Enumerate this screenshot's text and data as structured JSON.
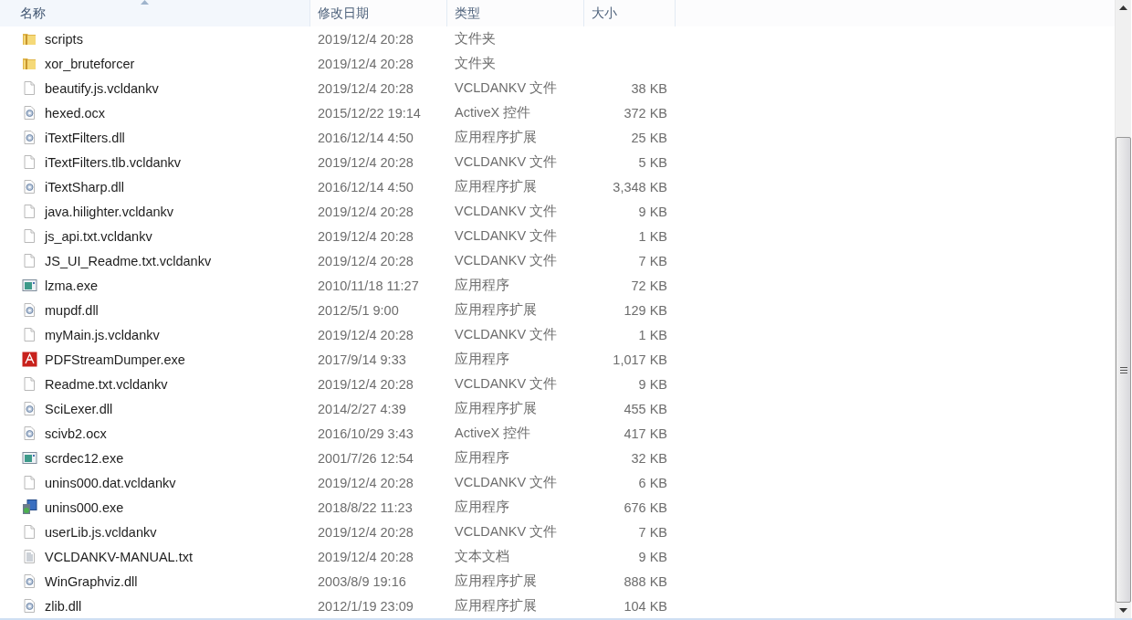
{
  "columns": [
    {
      "label": "名称",
      "sorted": true
    },
    {
      "label": "修改日期",
      "sorted": false
    },
    {
      "label": "类型",
      "sorted": false
    },
    {
      "label": "大小",
      "sorted": false
    }
  ],
  "files": [
    {
      "kind": "folder",
      "name": "scripts",
      "date": "2019/12/4 20:28",
      "type": "文件夹"
    },
    {
      "kind": "folder",
      "name": "xor_bruteforcer",
      "date": "2019/12/4 20:28",
      "type": "文件夹"
    },
    {
      "kind": "blank",
      "name": "beautify.js.vcldankv",
      "date": "2019/12/4 20:28",
      "type": "VCLDANKV 文件",
      "size": "38 KB"
    },
    {
      "kind": "library",
      "name": "hexed.ocx",
      "date": "2015/12/22 19:14",
      "type": "ActiveX 控件",
      "size": "372 KB"
    },
    {
      "kind": "library",
      "name": "iTextFilters.dll",
      "date": "2016/12/14 4:50",
      "type": "应用程序扩展",
      "size": "25 KB"
    },
    {
      "kind": "blank",
      "name": "iTextFilters.tlb.vcldankv",
      "date": "2019/12/4 20:28",
      "type": "VCLDANKV 文件",
      "size": "5 KB"
    },
    {
      "kind": "library",
      "name": "iTextSharp.dll",
      "date": "2016/12/14 4:50",
      "type": "应用程序扩展",
      "size": "3,348 KB"
    },
    {
      "kind": "blank",
      "name": "java.hilighter.vcldankv",
      "date": "2019/12/4 20:28",
      "type": "VCLDANKV 文件",
      "size": "9 KB"
    },
    {
      "kind": "blank",
      "name": "js_api.txt.vcldankv",
      "date": "2019/12/4 20:28",
      "type": "VCLDANKV 文件",
      "size": "1 KB"
    },
    {
      "kind": "blank",
      "name": "JS_UI_Readme.txt.vcldankv",
      "date": "2019/12/4 20:28",
      "type": "VCLDANKV 文件",
      "size": "7 KB"
    },
    {
      "kind": "program",
      "name": "lzma.exe",
      "date": "2010/11/18 11:27",
      "type": "应用程序",
      "size": "72 KB"
    },
    {
      "kind": "library",
      "name": "mupdf.dll",
      "date": "2012/5/1 9:00",
      "type": "应用程序扩展",
      "size": "129 KB"
    },
    {
      "kind": "blank",
      "name": "myMain.js.vcldankv",
      "date": "2019/12/4 20:28",
      "type": "VCLDANKV 文件",
      "size": "1 KB"
    },
    {
      "kind": "pdf",
      "name": "PDFStreamDumper.exe",
      "date": "2017/9/14 9:33",
      "type": "应用程序",
      "size": "1,017 KB"
    },
    {
      "kind": "blank",
      "name": "Readme.txt.vcldankv",
      "date": "2019/12/4 20:28",
      "type": "VCLDANKV 文件",
      "size": "9 KB"
    },
    {
      "kind": "library",
      "name": "SciLexer.dll",
      "date": "2014/2/27 4:39",
      "type": "应用程序扩展",
      "size": "455 KB"
    },
    {
      "kind": "library",
      "name": "scivb2.ocx",
      "date": "2016/10/29 3:43",
      "type": "ActiveX 控件",
      "size": "417 KB"
    },
    {
      "kind": "program",
      "name": "scrdec12.exe",
      "date": "2001/7/26 12:54",
      "type": "应用程序",
      "size": "32 KB"
    },
    {
      "kind": "blank",
      "name": "unins000.dat.vcldankv",
      "date": "2019/12/4 20:28",
      "type": "VCLDANKV 文件",
      "size": "6 KB"
    },
    {
      "kind": "installer",
      "name": "unins000.exe",
      "date": "2018/8/22 11:23",
      "type": "应用程序",
      "size": "676 KB"
    },
    {
      "kind": "blank",
      "name": "userLib.js.vcldankv",
      "date": "2019/12/4 20:28",
      "type": "VCLDANKV 文件",
      "size": "7 KB"
    },
    {
      "kind": "text",
      "name": "VCLDANKV-MANUAL.txt",
      "date": "2019/12/4 20:28",
      "type": "文本文档",
      "size": "9 KB"
    },
    {
      "kind": "library",
      "name": "WinGraphviz.dll",
      "date": "2003/8/9 19:16",
      "type": "应用程序扩展",
      "size": "888 KB"
    },
    {
      "kind": "library",
      "name": "zlib.dll",
      "date": "2012/1/19 23:09",
      "type": "应用程序扩展",
      "size": "104 KB"
    }
  ]
}
